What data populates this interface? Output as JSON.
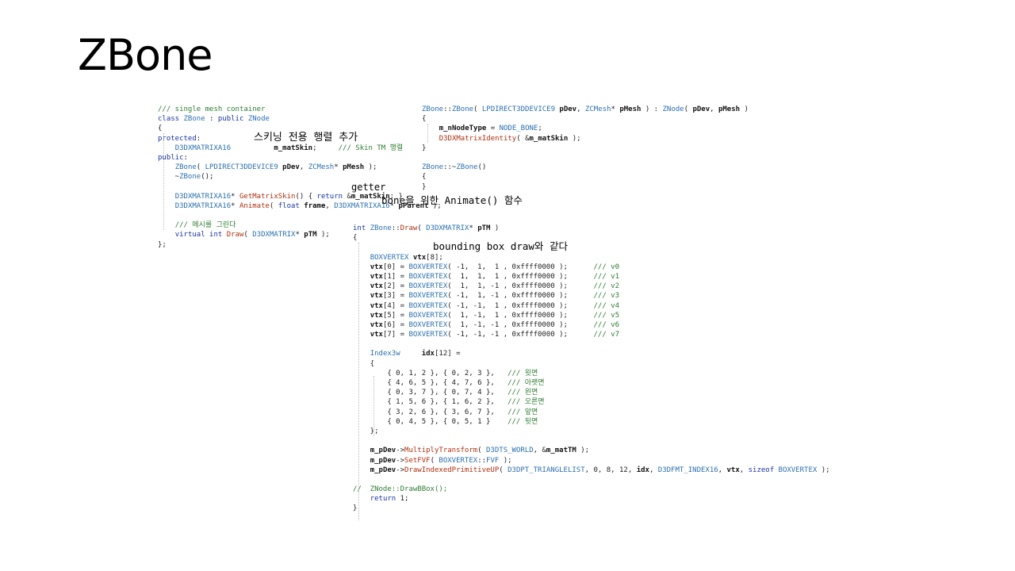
{
  "slide": {
    "title": "ZBone"
  },
  "annotations": {
    "skinning": "스키닝 전용 행렬 추가",
    "getter": "getter",
    "animate": "bone을 위한 Animate() 함수",
    "bbox": "bounding box draw와 같다"
  },
  "code": {
    "class_decl": [
      "/// single mesh container",
      "class ZBone : public ZNode",
      "{",
      "protected:",
      "    D3DXMATRIXA16          m_matSkin;     /// Skin TM 행렬",
      "public:",
      "    ZBone( LPDIRECT3DDEVICE9 pDev, ZCMesh* pMesh );",
      "    ~ZBone();",
      "",
      "    D3DXMATRIXA16* GetMatrixSkin() { return &m_matSkin; }",
      "    D3DXMATRIXA16* Animate( float frame, D3DXMATRIXA16* pParent );",
      "",
      "    /// 메시를 그린다",
      "    virtual int Draw( D3DXMATRIX* pTM );",
      "};"
    ],
    "ctor_impl": [
      "ZBone::ZBone( LPDIRECT3DDEVICE9 pDev, ZCMesh* pMesh ) : ZNode( pDev, pMesh )",
      "{",
      "    m_nNodeType = NODE_BONE;",
      "    D3DXMatrixIdentity( &m_matSkin );",
      "}",
      "",
      "ZBone::~ZBone()",
      "{",
      "}"
    ],
    "draw_impl": [
      "int ZBone::Draw( D3DXMATRIX* pTM )",
      "{",
      "",
      "    BOXVERTEX vtx[8];",
      "    vtx[0] = BOXVERTEX( -1,  1,  1 , 0xffff0000 );      /// v0",
      "    vtx[1] = BOXVERTEX(  1,  1,  1 , 0xffff0000 );      /// v1",
      "    vtx[2] = BOXVERTEX(  1,  1, -1 , 0xffff0000 );      /// v2",
      "    vtx[3] = BOXVERTEX( -1,  1, -1 , 0xffff0000 );      /// v3",
      "    vtx[4] = BOXVERTEX( -1, -1,  1 , 0xffff0000 );      /// v4",
      "    vtx[5] = BOXVERTEX(  1, -1,  1 , 0xffff0000 );      /// v5",
      "    vtx[6] = BOXVERTEX(  1, -1, -1 , 0xffff0000 );      /// v6",
      "    vtx[7] = BOXVERTEX( -1, -1, -1 , 0xffff0000 );      /// v7",
      "",
      "    Index3w     idx[12] =",
      "    {",
      "        { 0, 1, 2 }, { 0, 2, 3 },   /// 윗면",
      "        { 4, 6, 5 }, { 4, 7, 6 },   /// 아랫면",
      "        { 0, 3, 7 }, { 0, 7, 4 },   /// 왼면",
      "        { 1, 5, 6 }, { 1, 6, 2 },   /// 오른면",
      "        { 3, 2, 6 }, { 3, 6, 7 },   /// 앞면",
      "        { 0, 4, 5 }, { 0, 5, 1 }    /// 뒷면",
      "    };",
      "",
      "    m_pDev->MultiplyTransform( D3DTS_WORLD, &m_matTM );",
      "    m_pDev->SetFVF( BOXVERTEX::FVF );",
      "    m_pDev->DrawIndexedPrimitiveUP( D3DPT_TRIANGLELIST, 0, 8, 12, idx, D3DFMT_INDEX16, vtx, sizeof BOXVERTEX );",
      "",
      "//  ZNode::DrawBBox();",
      "    return 1;",
      "}"
    ]
  }
}
